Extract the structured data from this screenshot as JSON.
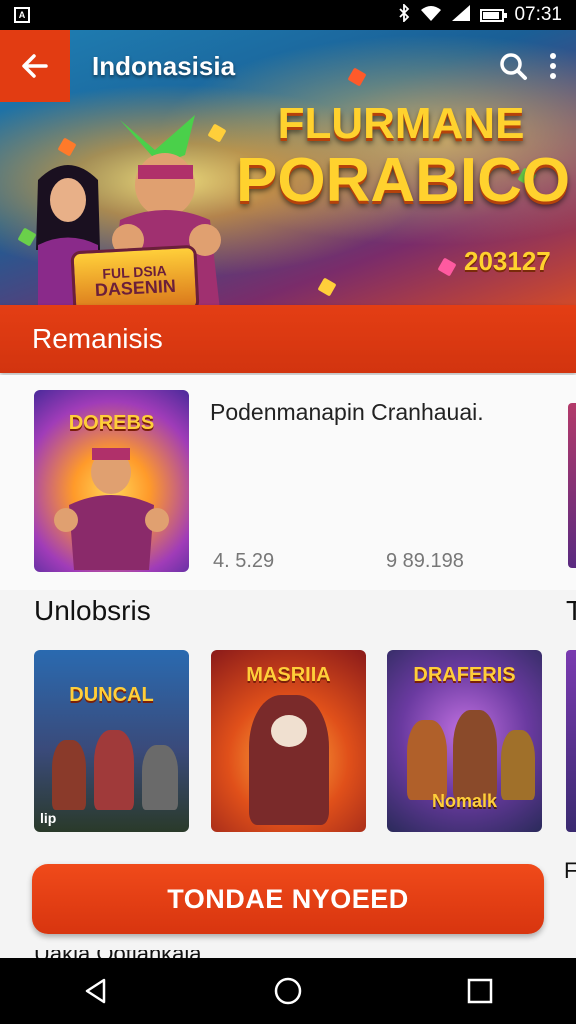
{
  "status_bar": {
    "app_notification_icon": "app-notification-icon",
    "app_notification_glyph": "A",
    "icons": [
      "bluetooth-icon",
      "wifi-icon",
      "signal-icon",
      "battery-icon"
    ],
    "time": "07:31"
  },
  "toolbar": {
    "title": "Indonasisia",
    "back_icon": "back-arrow-icon",
    "search_icon": "search-icon",
    "menu_icon": "more-vertical-icon"
  },
  "banner": {
    "title_line1": "FLURMANE",
    "title_line2": "PORABICO",
    "year": "203127",
    "logo_line1": "FUL DSIA",
    "logo_line2": "DASENIN"
  },
  "section_header": {
    "label": "Remanisis"
  },
  "featured": {
    "title": "Podenmanapin Cranhauai.",
    "thumb_label": "DOREBS",
    "rating": "4. 5.29",
    "downloads": "9 89.198"
  },
  "section2": {
    "title": "Unlobsris",
    "peek": "T",
    "tiles": [
      {
        "label": "DUNCAL",
        "sub": "",
        "corner": "lip"
      },
      {
        "label": "MASRIIA",
        "sub": "",
        "corner": ""
      },
      {
        "label": "DRAFERIS",
        "sub": "Nomalk",
        "corner": ""
      }
    ]
  },
  "cta": {
    "label": "TONDAE NYOEED",
    "peek": "F"
  },
  "cutoff_text": "Uakla Ootlankaia",
  "nav": {
    "back_icon": "nav-back-icon",
    "home_icon": "nav-home-icon",
    "recents_icon": "nav-recents-icon"
  },
  "colors": {
    "accent": "#e23c12",
    "cta": "#e8401a",
    "status_bar": "#000000"
  }
}
